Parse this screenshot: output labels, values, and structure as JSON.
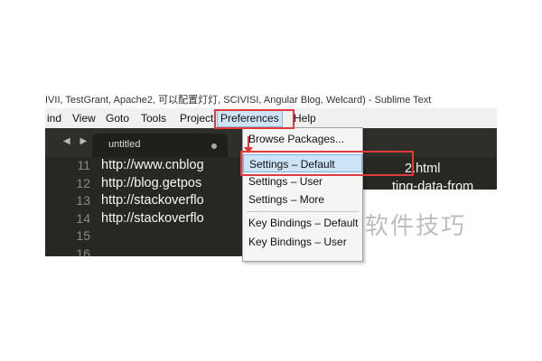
{
  "window": {
    "title_fragment": "IVII, TestGrant, Apache2, 可以配置灯灯, SCIVISI, Angular Blog, Welcard) - Sublime Text"
  },
  "menubar": {
    "items": [
      {
        "label": "ind"
      },
      {
        "label": "View"
      },
      {
        "label": "Goto"
      },
      {
        "label": "Tools"
      },
      {
        "label": "Project"
      },
      {
        "label": "Preferences"
      },
      {
        "label": "Help"
      }
    ],
    "active": "Preferences"
  },
  "tabs": {
    "nav_arrows": "◀ ▶",
    "active_tab": "untitled"
  },
  "editor": {
    "line_numbers": [
      "11",
      "12",
      "13",
      "14",
      "15",
      "16"
    ],
    "lines": [
      "http://www.cnblog",
      "http://blog.getpos",
      "http://stackoverflo",
      "http://stackoverflo",
      "",
      ""
    ],
    "right_fragment_1": "2.html",
    "right_fragment_2": "ting-data-from"
  },
  "dropdown": {
    "items": [
      {
        "label": "Browse Packages..."
      },
      {
        "label": "Settings – Default",
        "highlighted": true
      },
      {
        "label": "Settings – User"
      },
      {
        "label": "Settings – More"
      },
      {
        "label": "Key Bindings – Default"
      },
      {
        "label": "Key Bindings – User"
      }
    ]
  },
  "watermark": {
    "text": "软件技巧"
  },
  "colors": {
    "annotation_red": "#e23a3a",
    "editor_bg": "#272822",
    "menu_highlight": "#cde3f8"
  }
}
